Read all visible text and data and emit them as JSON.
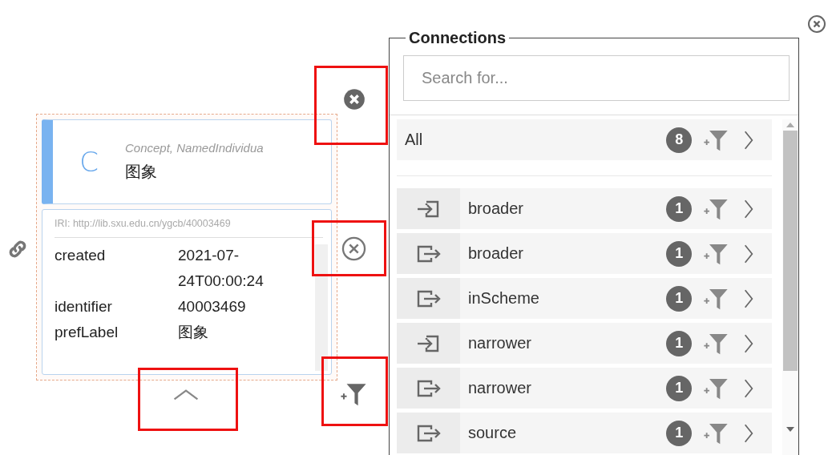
{
  "node": {
    "icon_letter": "C",
    "types": "Concept, NamedIndividua",
    "label": "图象",
    "iri": "IRI: http://lib.sxu.edu.cn/ygcb/40003469",
    "properties": [
      {
        "name": "created",
        "value": "2021-07-24T00:00:24"
      },
      {
        "name": "identifier",
        "value": "40003469"
      },
      {
        "name": "prefLabel",
        "value": "图象"
      }
    ]
  },
  "connections": {
    "title": "Connections",
    "search": {
      "placeholder": "Search for..."
    },
    "all": {
      "label": "All",
      "count": "8"
    },
    "items": [
      {
        "label": "broader",
        "count": "1",
        "kind": "in"
      },
      {
        "label": "broader",
        "count": "1",
        "kind": "out"
      },
      {
        "label": "inScheme",
        "count": "1",
        "kind": "out"
      },
      {
        "label": "narrower",
        "count": "1",
        "kind": "in"
      },
      {
        "label": "narrower",
        "count": "1",
        "kind": "out"
      },
      {
        "label": "source",
        "count": "1",
        "kind": "out"
      }
    ]
  }
}
